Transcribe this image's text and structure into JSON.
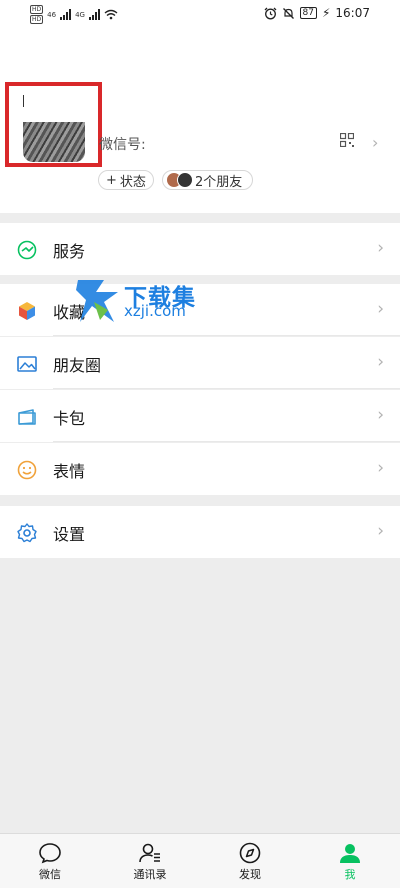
{
  "status_bar": {
    "hd1": "HD",
    "hd2": "HD",
    "net1": "46",
    "net2": "4G",
    "battery": "87",
    "time": "16:07"
  },
  "profile": {
    "wechat_id_label": "微信号:",
    "status_chip": "状态",
    "friends_chip": "2个朋友"
  },
  "menu": {
    "service": "服务",
    "favorites": "收藏",
    "moments": "朋友圈",
    "cards": "卡包",
    "stickers": "表情",
    "settings": "设置"
  },
  "watermark": {
    "title": "下载集",
    "url": "xzji.com"
  },
  "tabs": [
    {
      "label": "微信",
      "icon": "chat-icon"
    },
    {
      "label": "通讯录",
      "icon": "contacts-icon"
    },
    {
      "label": "发现",
      "icon": "discover-icon"
    },
    {
      "label": "我",
      "icon": "me-icon"
    }
  ],
  "colors": {
    "accent": "#07c160",
    "highlight_box": "#d9282a",
    "watermark": "#1d7fe0"
  }
}
